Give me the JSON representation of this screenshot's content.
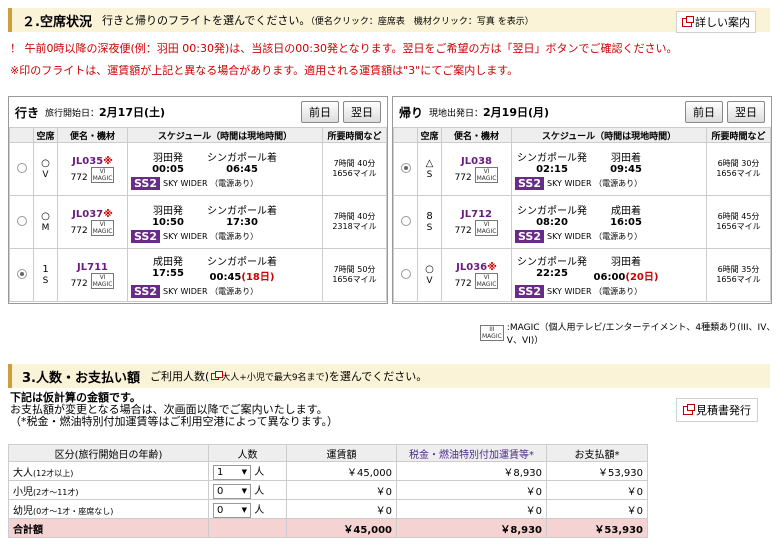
{
  "section2": {
    "title": "２.空席状況",
    "subtitle": "行きと帰りのフライトを選んでください。",
    "subtitle_hint": "（便名クリック：座席表　機材クリック：写真 を表示）",
    "detail_link": "詳しい案内",
    "notice1": "！ 午前0時以降の深夜便(例：羽田 00:30発)は、当該日の00:30発となります。翌日をご希望の方は「翌日」ボタンでご確認ください。",
    "notice2": "※印のフライトは、運賃額が上記と異なる場合があります。適用される運賃額は\"3\"にてご案内します。"
  },
  "outbound": {
    "label": "行き",
    "date_prefix": "旅行開始日：",
    "date": "2月17日(土)",
    "prev": "前日",
    "next": "翌日",
    "headers": [
      "空席",
      "便名・機材",
      "スケジュール（時間は現地時間）",
      "所要時間など"
    ],
    "flights": [
      {
        "selected": false,
        "seat": "○",
        "seat_code": "V",
        "flight": "JL035",
        "mark": "※",
        "aircraft": "772",
        "dep_place": "羽田発",
        "arr_place": "シンガポール着",
        "dep_time": "00:05",
        "arr_time": "06:45",
        "arr_extra": "",
        "ss2": "SS2",
        "ss2_text": "SKY WIDER （電源あり）",
        "duration": "7時間 40分",
        "miles": "1656マイル"
      },
      {
        "selected": false,
        "seat": "○",
        "seat_code": "M",
        "flight": "JL037",
        "mark": "※",
        "aircraft": "772",
        "dep_place": "羽田発",
        "arr_place": "シンガポール着",
        "dep_time": "10:50",
        "arr_time": "17:30",
        "arr_extra": "",
        "ss2": "SS2",
        "ss2_text": "SKY WIDER （電源あり）",
        "duration": "7時間 40分",
        "miles": "2318マイル"
      },
      {
        "selected": true,
        "seat": "1",
        "seat_code": "S",
        "flight": "JL711",
        "mark": "",
        "aircraft": "772",
        "dep_place": "成田発",
        "arr_place": "シンガポール着",
        "dep_time": "17:55",
        "arr_time": "00:45",
        "arr_extra": "(18日)",
        "ss2": "SS2",
        "ss2_text": "SKY WIDER （電源あり）",
        "duration": "7時間 50分",
        "miles": "1656マイル"
      }
    ]
  },
  "inbound": {
    "label": "帰り",
    "date_prefix": "現地出発日：",
    "date": "2月19日(月)",
    "prev": "前日",
    "next": "翌日",
    "headers": [
      "空席",
      "便名・機材",
      "スケジュール（時間は現地時間）",
      "所要時間など"
    ],
    "flights": [
      {
        "selected": true,
        "seat": "△",
        "seat_code": "S",
        "flight": "JL038",
        "mark": "",
        "aircraft": "772",
        "dep_place": "シンガポール発",
        "arr_place": "羽田着",
        "dep_time": "02:15",
        "arr_time": "09:45",
        "arr_extra": "",
        "ss2": "SS2",
        "ss2_text": "SKY WIDER （電源あり）",
        "duration": "6時間 30分",
        "miles": "1656マイル"
      },
      {
        "selected": false,
        "seat": "8",
        "seat_code": "S",
        "flight": "JL712",
        "mark": "",
        "aircraft": "772",
        "dep_place": "シンガポール発",
        "arr_place": "成田着",
        "dep_time": "08:20",
        "arr_time": "16:05",
        "arr_extra": "",
        "ss2": "SS2",
        "ss2_text": "SKY WIDER （電源あり）",
        "duration": "6時間 45分",
        "miles": "1656マイル"
      },
      {
        "selected": false,
        "seat": "○",
        "seat_code": "V",
        "flight": "JL036",
        "mark": "※",
        "aircraft": "772",
        "dep_place": "シンガポール発",
        "arr_place": "羽田着",
        "dep_time": "22:25",
        "arr_time": "06:00",
        "arr_extra": "(20日)",
        "ss2": "SS2",
        "ss2_text": "SKY WIDER （電源あり）",
        "duration": "6時間 35分",
        "miles": "1656マイル"
      }
    ]
  },
  "magic_legend": ":MAGIC（個人用テレビ/エンターテイメント、4種類あり(III、IV、V、VI)）",
  "section3": {
    "title": "3.人数・お支払い額",
    "subtitle_pre": "ご利用人数(",
    "subtitle_link": "大人+小児で最大9名まで",
    "subtitle_post": ")を選んでください。",
    "line1": "下記は仮計算の金額です。",
    "line2": "お支払額が変更となる場合は、次画面以降でご案内いたします。",
    "line3": "（*税金・燃油特別付加運賃等はご利用空港によって異なります。）",
    "estimate_button": "見積書発行",
    "headers": [
      "区分(旅行開始日の年齢)",
      "人数",
      "運賃額",
      "税金・燃油特別付加運賃等*",
      "お支払額*"
    ],
    "rows": [
      {
        "label": "大人",
        "label_sub": "(12才以上)",
        "count": "1",
        "unit": "人",
        "fare": "￥45,000",
        "tax": "￥8,930",
        "total": "￥53,930"
      },
      {
        "label": "小児",
        "label_sub": "(2才〜11才)",
        "count": "0",
        "unit": "人",
        "fare": "￥0",
        "tax": "￥0",
        "total": "￥0"
      },
      {
        "label": "幼児",
        "label_sub": "(0才〜1才・座席なし)",
        "count": "0",
        "unit": "人",
        "fare": "￥0",
        "tax": "￥0",
        "total": "￥0"
      }
    ],
    "total_row": {
      "label": "合計額",
      "fare": "￥45,000",
      "tax": "￥8,930",
      "total": "￥53,930"
    }
  }
}
